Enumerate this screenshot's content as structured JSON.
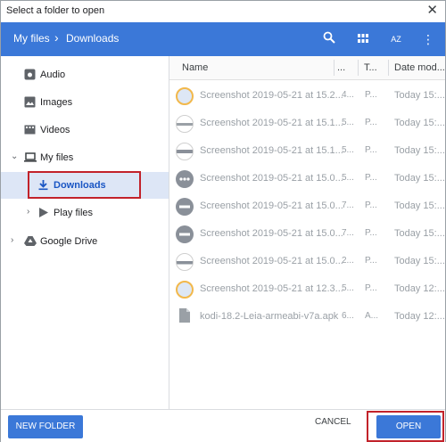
{
  "window": {
    "title": "Select a folder to open",
    "close_glyph": "✕"
  },
  "toolbar": {
    "breadcrumb": [
      "My files",
      "Downloads"
    ],
    "separator": "›",
    "sort_glyph": "AZ"
  },
  "sidebar": {
    "items": [
      {
        "label": "Audio",
        "icon": "audio-icon"
      },
      {
        "label": "Images",
        "icon": "images-icon"
      },
      {
        "label": "Videos",
        "icon": "videos-icon"
      },
      {
        "label": "My files",
        "icon": "laptop-icon",
        "expanded": true
      },
      {
        "label": "Downloads",
        "icon": "download-icon",
        "selected": true
      },
      {
        "label": "Play files",
        "icon": "play-icon"
      },
      {
        "label": "Google Drive",
        "icon": "drive-icon"
      }
    ]
  },
  "file_list": {
    "columns": [
      "Name",
      "...",
      "T...",
      "Date mod..."
    ],
    "rows": [
      {
        "name": "Screenshot 2019-05-21 at 15.2...",
        "size": "4...",
        "type": "P...",
        "date": "Today 15:..."
      },
      {
        "name": "Screenshot 2019-05-21 at 15.1...",
        "size": "5...",
        "type": "P...",
        "date": "Today 15:..."
      },
      {
        "name": "Screenshot 2019-05-21 at 15.1...",
        "size": "5...",
        "type": "P...",
        "date": "Today 15:..."
      },
      {
        "name": "Screenshot 2019-05-21 at 15.0...",
        "size": "5...",
        "type": "P...",
        "date": "Today 15:..."
      },
      {
        "name": "Screenshot 2019-05-21 at 15.0...",
        "size": "7...",
        "type": "P...",
        "date": "Today 15:..."
      },
      {
        "name": "Screenshot 2019-05-21 at 15.0...",
        "size": "7...",
        "type": "P...",
        "date": "Today 15:..."
      },
      {
        "name": "Screenshot 2019-05-21 at 15.0...",
        "size": "2...",
        "type": "P...",
        "date": "Today 15:..."
      },
      {
        "name": "Screenshot 2019-05-21 at 12.3...",
        "size": "5...",
        "type": "P...",
        "date": "Today 12:..."
      },
      {
        "name": "kodi-18.2-Leia-armeabi-v7a.apk",
        "size": "6...",
        "type": "A...",
        "date": "Today 12:..."
      }
    ]
  },
  "footer": {
    "new_folder_label": "NEW FOLDER",
    "cancel_label": "CANCEL",
    "open_label": "OPEN"
  },
  "colors": {
    "accent": "#3b78d8",
    "highlight": "#c2222a",
    "selected_bg": "#dde6f6"
  }
}
